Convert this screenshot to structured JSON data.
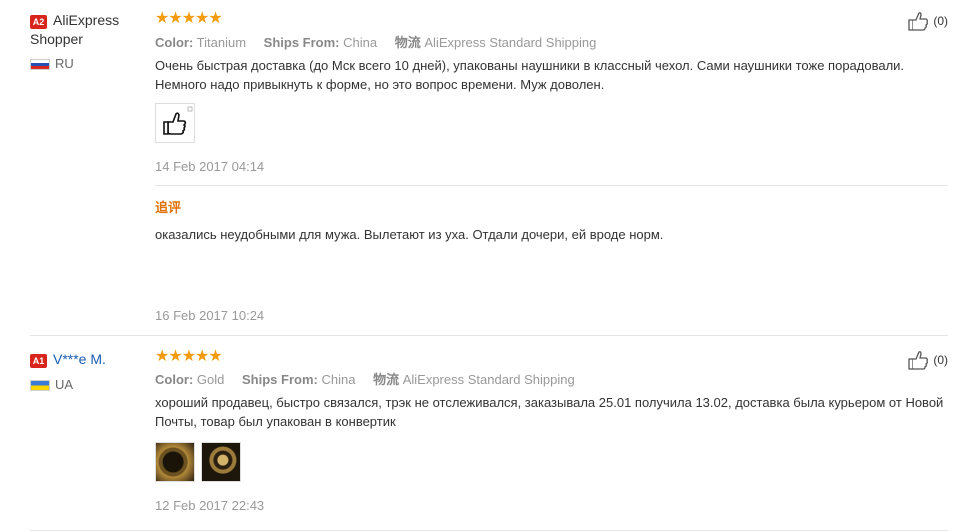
{
  "reviews": [
    {
      "level": "A2",
      "user_name": "AliExpress Shopper",
      "country": "RU",
      "stars": "★★★★★",
      "rating": 5,
      "color_label": "Color:",
      "color_value": "Titanium",
      "ships_label": "Ships From:",
      "ships_value": "China",
      "logistics_label": "物流",
      "logistics_value": "AliExpress Standard Shipping",
      "text": "Очень быстрая доставка (до Мск всего 10 дней), упакованы наушники в классный чехол. Сами наушники тоже порадовали. Немного надо привыкнуть к форме, но это вопрос времени. Муж доволен.",
      "date": "14 Feb 2017 04:14",
      "helpful_count": "(0)",
      "followup": {
        "label": "追评",
        "text": "оказались неудобными для мужа. Вылетают из уха. Отдали дочери, ей вроде норм.",
        "date": "16 Feb 2017 10:24"
      }
    },
    {
      "level": "A1",
      "user_name": "V***e M.",
      "country": "UA",
      "stars": "★★★★★",
      "rating": 5,
      "color_label": "Color:",
      "color_value": "Gold",
      "ships_label": "Ships From:",
      "ships_value": "China",
      "logistics_label": "物流",
      "logistics_value": "AliExpress Standard Shipping",
      "text": "хороший продавец, быстро связался, трэк не отслеживался, заказывала 25.01 получила 13.02, доставка была курьером от Новой Почты, товар был упакован в конвертик",
      "date": "12 Feb 2017 22:43",
      "helpful_count": "(0)"
    }
  ]
}
